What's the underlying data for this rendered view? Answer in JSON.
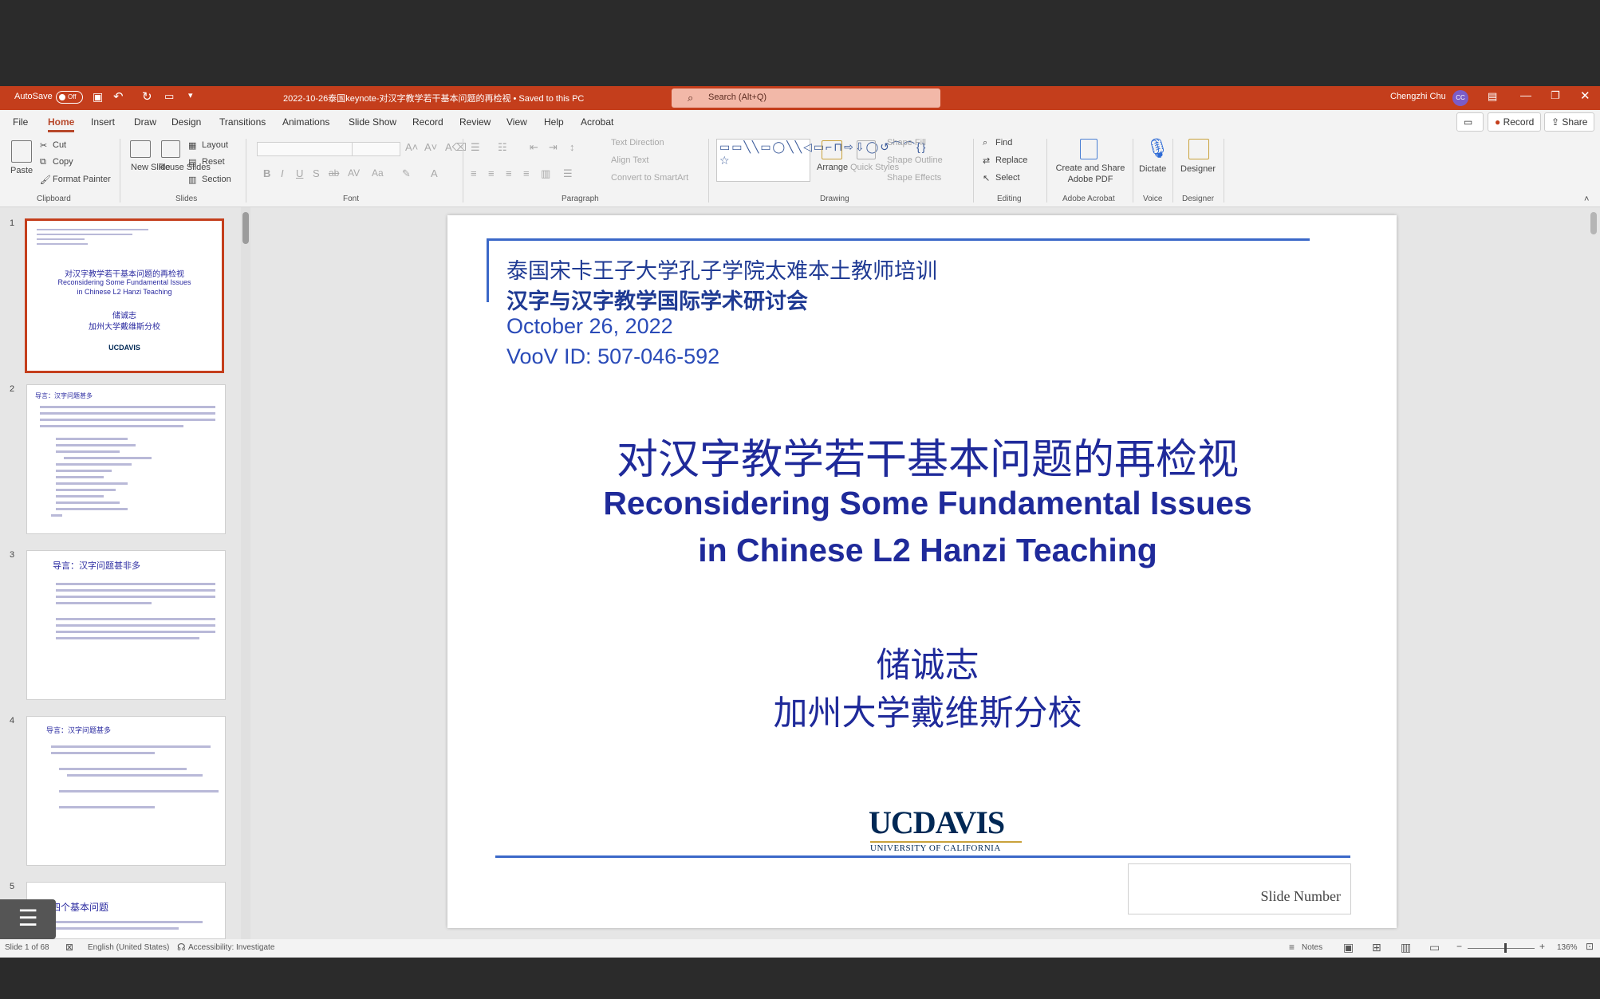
{
  "titlebar": {
    "autosave": "AutoSave",
    "autosave_state": "Off",
    "doc_title": "2022-10-26泰国keynote-对汉字教学若干基本问题的再检视 • Saved to this PC",
    "search_placeholder": "Search (Alt+Q)",
    "user": "Chengzhi Chu",
    "initials": "CC"
  },
  "menu": {
    "tabs": [
      "File",
      "Home",
      "Insert",
      "Draw",
      "Design",
      "Transitions",
      "Animations",
      "Slide Show",
      "Record",
      "Review",
      "View",
      "Help",
      "Acrobat"
    ],
    "record": "Record",
    "share": "Share"
  },
  "ribbon": {
    "paste": "Paste",
    "cut": "Cut",
    "copy": "Copy",
    "format_painter": "Format Painter",
    "clipboard": "Clipboard",
    "new_slide": "New Slide",
    "reuse_slides": "Reuse Slides",
    "layout": "Layout",
    "reset": "Reset",
    "section": "Section",
    "slides": "Slides",
    "font": "Font",
    "text_direction": "Text Direction",
    "align_text": "Align Text",
    "convert_smartart": "Convert to SmartArt",
    "paragraph": "Paragraph",
    "arrange": "Arrange",
    "quick_styles": "Quick Styles",
    "shape_fill": "Shape Fill",
    "shape_outline": "Shape Outline",
    "shape_effects": "Shape Effects",
    "drawing": "Drawing",
    "find": "Find",
    "replace": "Replace",
    "select": "Select",
    "editing": "Editing",
    "create_share_pdf": "Create and Share Adobe PDF",
    "adobe_acrobat": "Adobe Acrobat",
    "dictate": "Dictate",
    "voice": "Voice",
    "designer": "Designer",
    "designer_group": "Designer"
  },
  "thumbnails": [
    {
      "num": "1",
      "l1": "对汉字教学若干基本问题的再检视",
      "l2": "Reconsidering Some Fundamental Issues",
      "l3": "in Chinese L2 Hanzi Teaching",
      "l4": "储诚志",
      "l5": "加州大学戴维斯分校",
      "logo": "UCDAVIS"
    },
    {
      "num": "2",
      "title": "导言：汉字问题甚多"
    },
    {
      "num": "3",
      "title": "导言：汉字问题甚非多"
    },
    {
      "num": "4",
      "title": "导言：汉字问题甚多"
    },
    {
      "num": "5",
      "title": "四个基本问题"
    }
  ],
  "slide": {
    "line1": "泰国宋卡王子大学孔子学院太难本土教师培训",
    "line2": "汉字与汉字教学国际学术研讨会",
    "line3": "October 26, 2022",
    "line4": "VooV ID: 507-046-592",
    "title_cn": "对汉字教学若干基本问题的再检视",
    "title_en1": "Reconsidering Some Fundamental Issues",
    "title_en2": "in Chinese L2 Hanzi Teaching",
    "author": "储诚志",
    "affiliation": "加州大学戴维斯分校",
    "logo": "UCDAVIS",
    "logo_sub": "UNIVERSITY OF CALIFORNIA",
    "slide_number_placeholder": "Slide Number"
  },
  "status": {
    "slide_of": "Slide 1 of 68",
    "language": "English (United States)",
    "accessibility": "Accessibility: Investigate",
    "notes": "Notes",
    "zoom": "136%"
  },
  "colors": {
    "accent": "#c43e1c",
    "slide_text": "#1f3a93",
    "ucdavis_blue": "#002855"
  }
}
